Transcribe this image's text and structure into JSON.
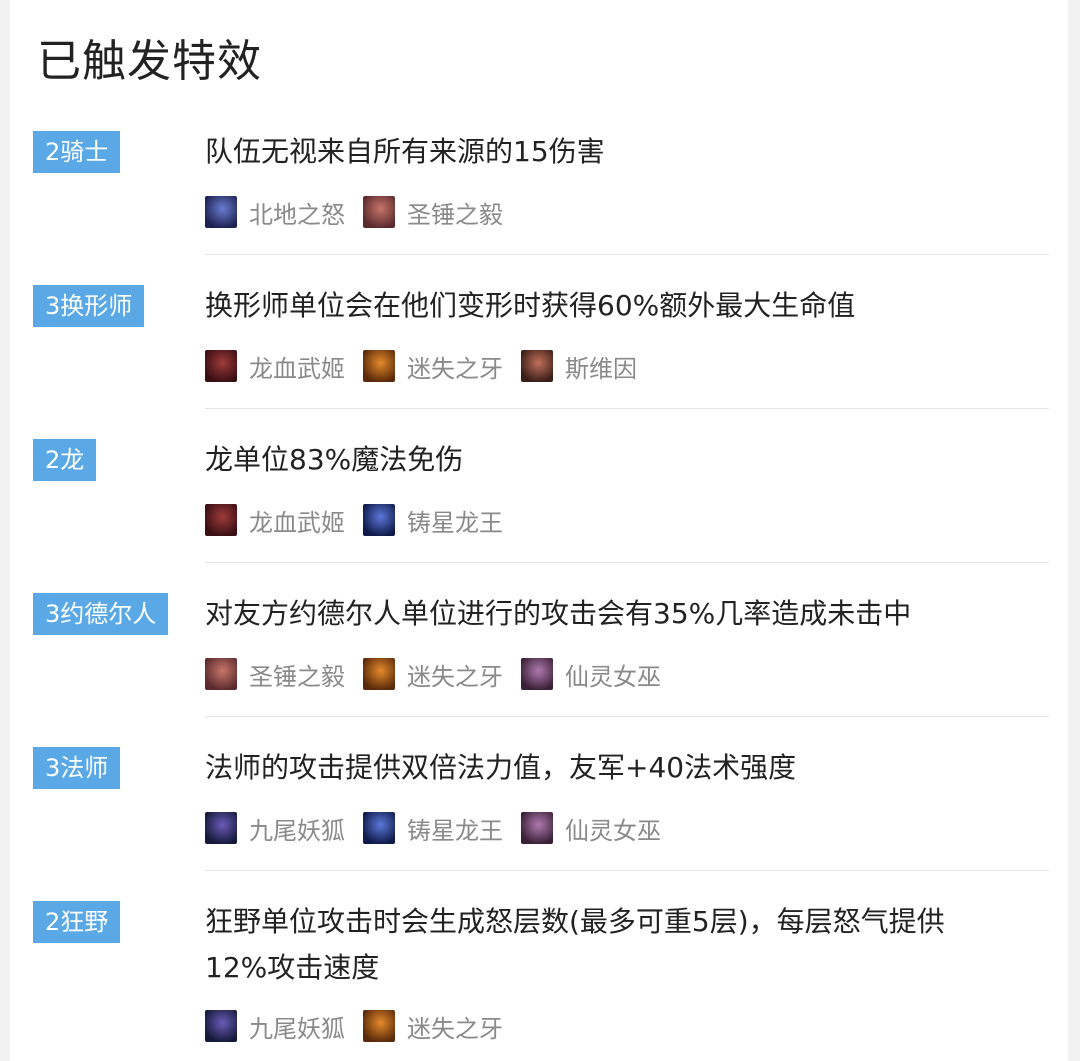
{
  "page": {
    "title": "已触发特效"
  },
  "traits": [
    {
      "badge": "2骑士",
      "desc_lines": [
        "队伍无视来自所有来源的15伤害"
      ],
      "units": [
        {
          "name": "北地之怒",
          "colors": [
            "#1d2350",
            "#6a7bd0"
          ]
        },
        {
          "name": "圣锤之毅",
          "colors": [
            "#5b2a2e",
            "#c8766a"
          ]
        }
      ]
    },
    {
      "badge": "3换形师",
      "desc_lines": [
        "换形师单位会在他们变形时获得60%额外最大生命值"
      ],
      "units": [
        {
          "name": "龙血武姬",
          "colors": [
            "#3a0f14",
            "#9e3a3a"
          ]
        },
        {
          "name": "迷失之牙",
          "colors": [
            "#5a2a0a",
            "#e48a2a"
          ]
        },
        {
          "name": "斯维因",
          "colors": [
            "#3b1e18",
            "#c0705a"
          ]
        }
      ]
    },
    {
      "badge": "2龙",
      "desc_lines": [
        "龙单位83%魔法免伤"
      ],
      "units": [
        {
          "name": "龙血武姬",
          "colors": [
            "#3a0f14",
            "#9e3a3a"
          ]
        },
        {
          "name": "铸星龙王",
          "colors": [
            "#101a4a",
            "#5a78d8"
          ]
        }
      ]
    },
    {
      "badge": "3约德尔人",
      "desc_lines": [
        "对友方约德尔人单位进行的攻击会有35%几率造成未击中"
      ],
      "units": [
        {
          "name": "圣锤之毅",
          "colors": [
            "#5b2a2e",
            "#c8766a"
          ]
        },
        {
          "name": "迷失之牙",
          "colors": [
            "#5a2a0a",
            "#e48a2a"
          ]
        },
        {
          "name": "仙灵女巫",
          "colors": [
            "#3a2036",
            "#b07ab0"
          ]
        }
      ]
    },
    {
      "badge": "3法师",
      "desc_lines": [
        "法师的攻击提供双倍法力值，友军+40法术强度"
      ],
      "units": [
        {
          "name": "九尾妖狐",
          "colors": [
            "#151a3a",
            "#6a5ab8"
          ]
        },
        {
          "name": "铸星龙王",
          "colors": [
            "#101a4a",
            "#5a78d8"
          ]
        },
        {
          "name": "仙灵女巫",
          "colors": [
            "#3a2036",
            "#b07ab0"
          ]
        }
      ]
    },
    {
      "badge": "2狂野",
      "desc_lines": [
        "狂野单位攻击时会生成怒层数(最多可重5层)，每层怒气提供",
        "12%攻击速度"
      ],
      "units": [
        {
          "name": "九尾妖狐",
          "colors": [
            "#151a3a",
            "#6a5ab8"
          ]
        },
        {
          "name": "迷失之牙",
          "colors": [
            "#5a2a0a",
            "#e48a2a"
          ]
        }
      ]
    }
  ]
}
